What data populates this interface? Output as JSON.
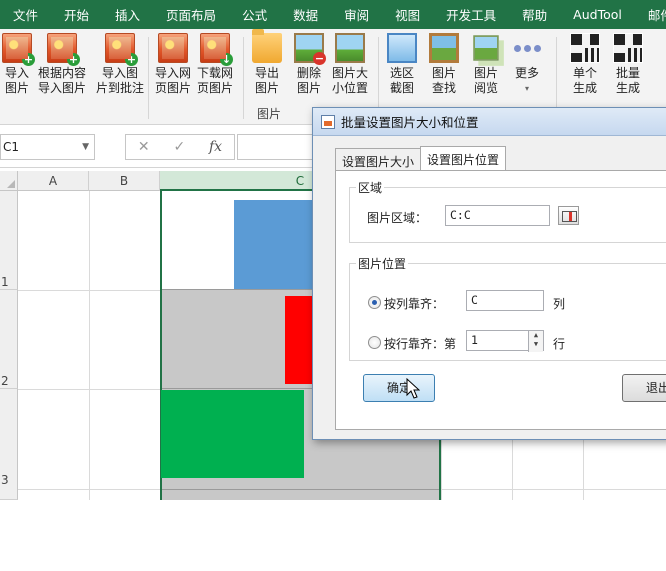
{
  "ribbon_tabs": [
    "文件",
    "开始",
    "插入",
    "页面布局",
    "公式",
    "数据",
    "审阅",
    "视图",
    "开发工具",
    "帮助",
    "AudTool",
    "邮件"
  ],
  "ribbon_buttons": {
    "import_image": [
      "导入",
      "图片"
    ],
    "import_by_content": [
      "根据内容",
      "导入图片"
    ],
    "import_to_comment": [
      "导入图",
      "片到批注"
    ],
    "import_web": [
      "导入网",
      "页图片"
    ],
    "download_web": [
      "下载网",
      "页图片"
    ],
    "export_image": [
      "导出",
      "图片"
    ],
    "delete_image": [
      "删除",
      "图片"
    ],
    "resize_position": [
      "图片大",
      "小位置"
    ],
    "select_area_screenshot": [
      "选区",
      "截图"
    ],
    "find_image": [
      "图片",
      "查找"
    ],
    "browse_image": [
      "图片",
      "阅览"
    ],
    "more": [
      "更多",
      "▾"
    ],
    "single_generate": [
      "单个",
      "生成"
    ],
    "batch_generate": [
      "批量",
      "生成"
    ]
  },
  "ribbon_group_label": "图片",
  "formula_bar": {
    "name_box": "C1",
    "cancel_symbol": "✕",
    "enter_symbol": "✓",
    "fx_symbol": "fx",
    "formula": ""
  },
  "grid": {
    "columns": [
      "A",
      "B",
      "C"
    ],
    "rows": [
      "1",
      "2",
      "3"
    ],
    "shape_colors": [
      "#5b9bd5",
      "#ff0000",
      "#00b050"
    ],
    "cell_fill": "#c8c8c8"
  },
  "dialog": {
    "title": "批量设置图片大小和位置",
    "tabs": [
      "设置图片大小",
      "设置图片位置"
    ],
    "active_tab": "设置图片位置",
    "region_group": "区域",
    "image_region_label": "图片区域：",
    "image_region_value": "C:C",
    "position_group": "图片位置",
    "align_by_column_label": "按列靠齐：",
    "align_by_column_value": "C",
    "column_unit": "列",
    "align_by_row_label": "按行靠齐：第",
    "align_by_row_value": "1",
    "row_unit": "行",
    "spin_up": "▲",
    "spin_down": "▼",
    "ok_button": "确定",
    "exit_button": "退出"
  }
}
